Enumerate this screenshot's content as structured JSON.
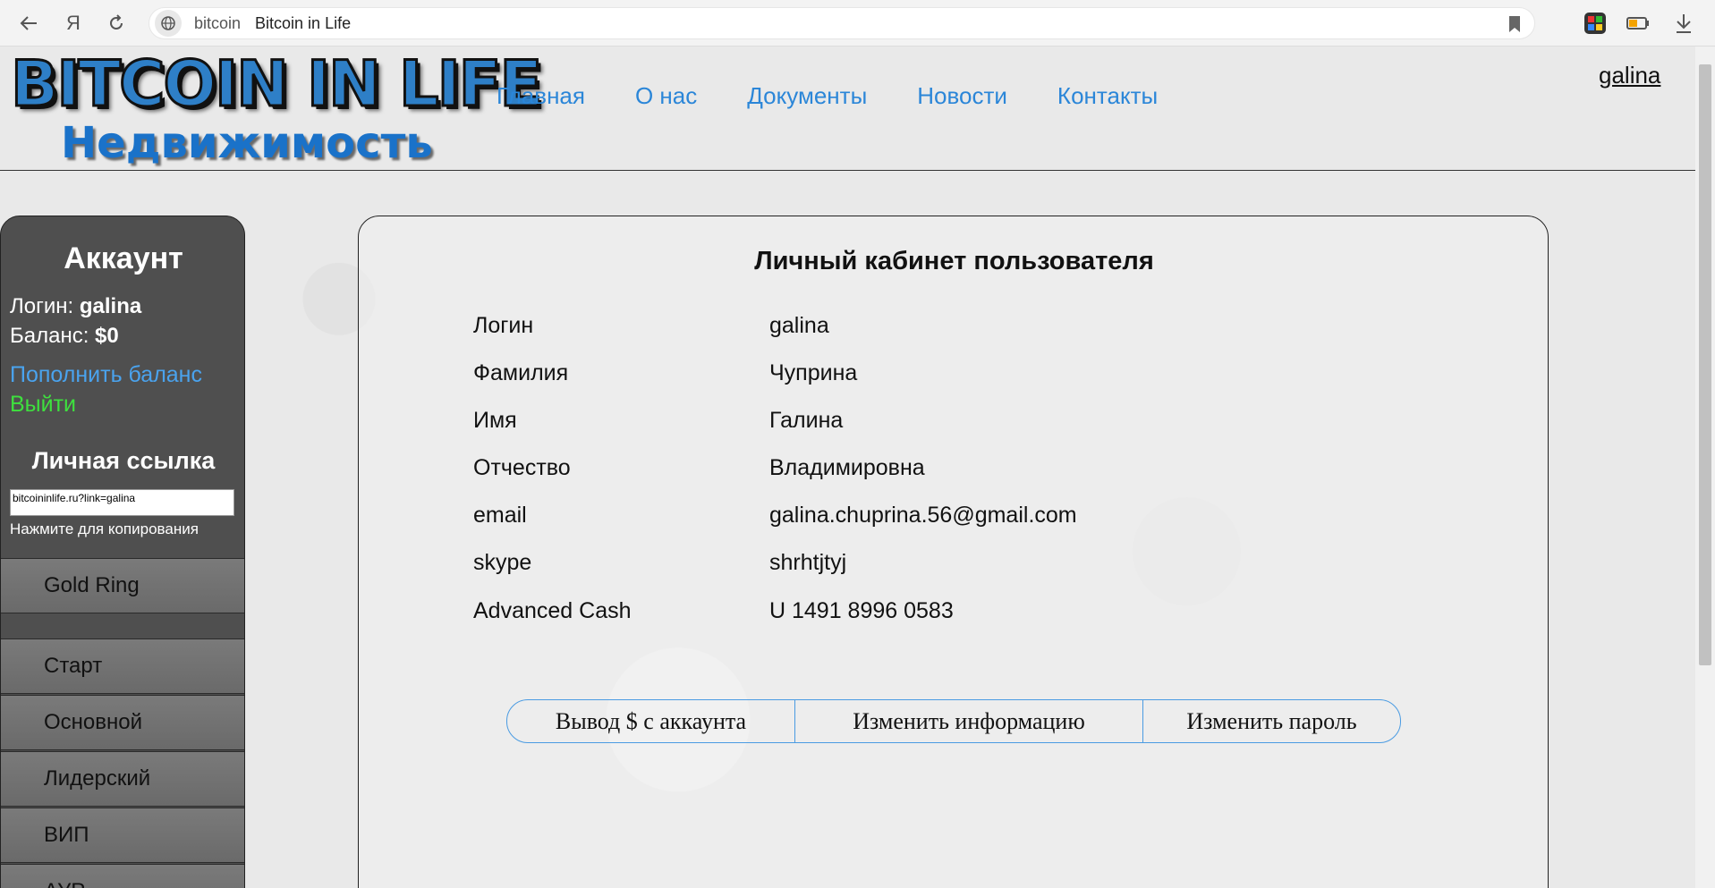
{
  "browser": {
    "domain": "bitcoin",
    "title": "Bitcoin in Life",
    "back_icon": "arrow-left-icon",
    "yandex_icon": "Я",
    "reload_icon": "reload-icon"
  },
  "header": {
    "logo": "BITCOIN IN LIFE",
    "subtitle": "Недвижимость",
    "nav": [
      "Главная",
      "О нас",
      "Документы",
      "Новости",
      "Контакты"
    ],
    "user": "galina"
  },
  "sidebar": {
    "title": "Аккаунт",
    "login_label": "Логин: ",
    "login_value": "galina",
    "balance_label": "Баланс: ",
    "balance_value": "$0",
    "topup": "Пополнить баланс",
    "logout": "Выйти",
    "link_title": "Личная ссылка",
    "link_value": "bitcoininlife.ru?link=galina",
    "copy_hint": "Нажмите для копирования",
    "items": [
      "Gold Ring",
      "Старт",
      "Основной",
      "Лидерский",
      "ВИП",
      "АУР"
    ]
  },
  "main": {
    "title": "Личный кабинет пользователя",
    "fields": [
      {
        "label": "Логин",
        "value": "galina"
      },
      {
        "label": "Фамилия",
        "value": "Чуприна"
      },
      {
        "label": "Имя",
        "value": "Галина"
      },
      {
        "label": "Отчество",
        "value": "Владимировна"
      },
      {
        "label": "email",
        "value": "galina.chuprina.56@gmail.com"
      },
      {
        "label": "skype",
        "value": "shrhtjtyj"
      },
      {
        "label": "Advanced Cash",
        "value": "U 1491 8996 0583"
      }
    ],
    "actions": [
      "Вывод $ с аккаунта",
      "Изменить информацию",
      "Изменить пароль"
    ]
  },
  "colors": {
    "link_blue": "#2b86d8",
    "logout_green": "#3ee03e",
    "sidebar_bg": "#4f4f4f",
    "action_border": "#4a9be2"
  }
}
